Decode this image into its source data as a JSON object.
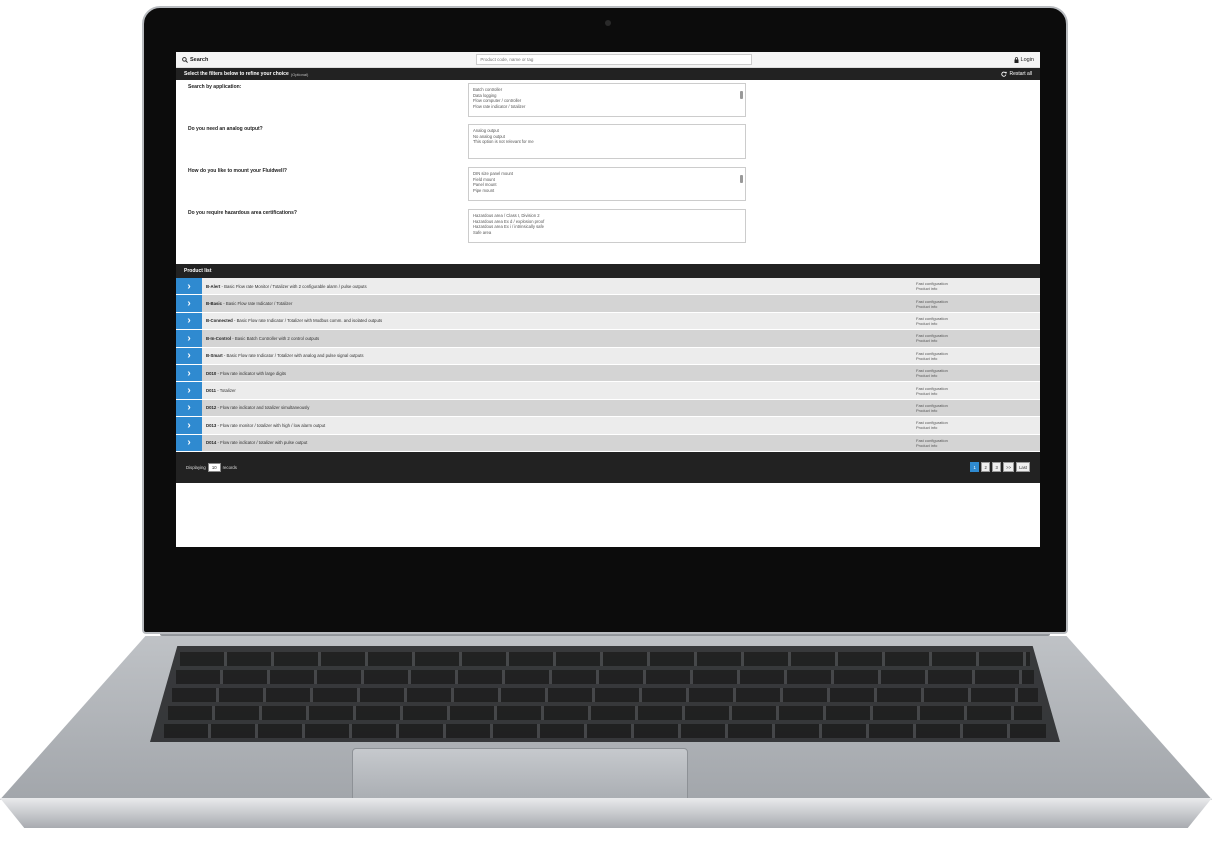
{
  "topbar": {
    "search_label": "Search",
    "search_placeholder": "Product code, name or tag",
    "login_label": "Login"
  },
  "filterbar": {
    "title": "Select the filters below to refine your choice",
    "optional": "(Optional)",
    "restart_label": "Restart all"
  },
  "filters": [
    {
      "question": "Search by application:",
      "options": [
        "Batch controller",
        "Data logging",
        "Flow computer / controller",
        "Flow rate indicator / totalizer"
      ]
    },
    {
      "question": "Do you need an analog output?",
      "options": [
        "Analog output",
        "No analog output",
        "This option is not relevant for me"
      ]
    },
    {
      "question": "How do you like to mount your Fluidwell?",
      "options": [
        "DIN size panel mount",
        "Field mount",
        "Panel mount",
        "Pipe mount"
      ]
    },
    {
      "question": "Do you require hazardous area certifications?",
      "options": [
        "Hazardous area / Class I, Division 2",
        "Hazardous area Ex d / explosion proof",
        "Hazardous area Ex i / intrinsically safe",
        "Safe area"
      ]
    }
  ],
  "product_list": {
    "title": "Product list",
    "link_fast": "Fast configuration",
    "link_info": "Product info",
    "items": [
      {
        "name": "B-Alert",
        "desc": " - Basic Flow rate Monitor / Totalizer with 2 configurable alarm / pulse outputs"
      },
      {
        "name": "B-Basic",
        "desc": " - Basic Flow rate Indicator / Totalizer"
      },
      {
        "name": "B-Connected",
        "desc": " - Basic Flow rate Indicator / Totalizer with Modbus comm. and isolated outputs"
      },
      {
        "name": "B-In-Control",
        "desc": " - Basic Batch Controller with 2 control outputs"
      },
      {
        "name": "B-Smart",
        "desc": " - Basic Flow rate Indicator / Totalizer with analog and pulse signal outputs"
      },
      {
        "name": "D010",
        "desc": " - Flow rate indicator with large digits"
      },
      {
        "name": "D011",
        "desc": " - Totalizer"
      },
      {
        "name": "D012",
        "desc": " - Flow rate indicator and totalizer simultaneously"
      },
      {
        "name": "D013",
        "desc": " - Flow rate monitor / totalizer with high / low alarm output"
      },
      {
        "name": "D014",
        "desc": " - Flow rate indicator / totalizer with pulse output"
      }
    ]
  },
  "footer": {
    "displaying": "Displaying",
    "count": "10",
    "records": "records",
    "pages": [
      "1",
      "2",
      "3",
      ">>",
      "Last"
    ],
    "active_page": "1"
  },
  "colors": {
    "accent": "#2f8ad0",
    "dark_bar": "#222222"
  }
}
